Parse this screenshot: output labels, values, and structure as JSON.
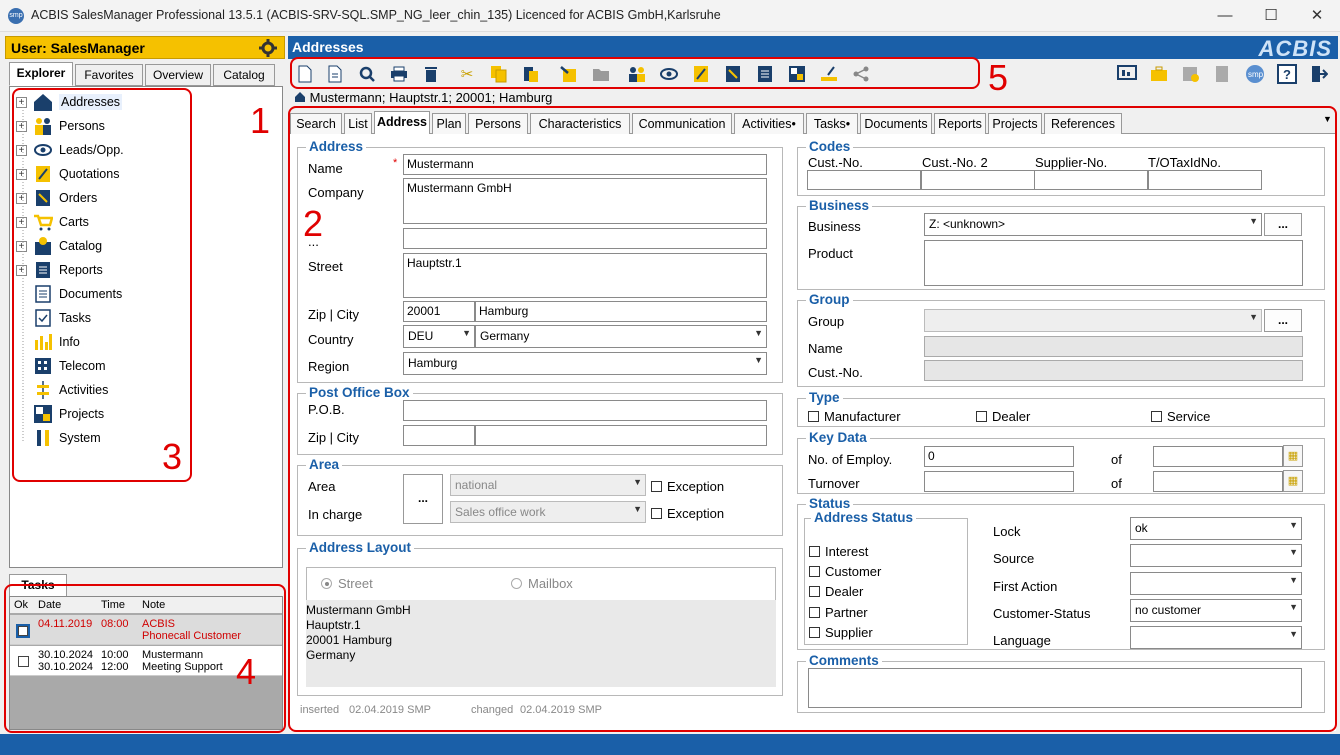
{
  "window": {
    "app_icon": "smp",
    "title": "ACBIS SalesManager Professional 13.5.1  (ACBIS-SRV-SQL.SMP_NG_leer_chin_135) Licenced for ACBIS GmbH,Karlsruhe",
    "minimize": "—",
    "maximize": "☐",
    "close": "✕"
  },
  "left": {
    "user_label": "User: SalesManager",
    "tabs": [
      "Explorer",
      "Favorites",
      "Overview",
      "Catalog"
    ],
    "tree": [
      {
        "label": "Addresses",
        "expandable": true,
        "icon": "house-icon"
      },
      {
        "label": "Persons",
        "expandable": true,
        "icon": "persons-icon"
      },
      {
        "label": "Leads/Opp.",
        "expandable": true,
        "icon": "eye-icon"
      },
      {
        "label": "Quotations",
        "expandable": true,
        "icon": "quotation-icon"
      },
      {
        "label": "Orders",
        "expandable": true,
        "icon": "orders-icon"
      },
      {
        "label": "Carts",
        "expandable": true,
        "icon": "cart-icon"
      },
      {
        "label": "Catalog",
        "expandable": true,
        "icon": "catalog-icon"
      },
      {
        "label": "Reports",
        "expandable": true,
        "icon": "reports-icon"
      },
      {
        "label": "Documents",
        "expandable": false,
        "icon": "documents-icon"
      },
      {
        "label": "Tasks",
        "expandable": false,
        "icon": "tasks-icon"
      },
      {
        "label": "Info",
        "expandable": false,
        "icon": "info-chart-icon"
      },
      {
        "label": "Telecom",
        "expandable": false,
        "icon": "telecom-icon"
      },
      {
        "label": "Activities",
        "expandable": false,
        "icon": "activities-icon"
      },
      {
        "label": "Projects",
        "expandable": false,
        "icon": "projects-icon"
      },
      {
        "label": "System",
        "expandable": false,
        "icon": "system-icon"
      }
    ],
    "tasks_tab": "Tasks",
    "task_columns": [
      "Ok",
      "Date",
      "Time",
      "Note"
    ],
    "task_rows": [
      {
        "date": "04.11.2019",
        "time": "08:00",
        "note1": "ACBIS",
        "note2": "Phonecall Customer",
        "overdue": true
      },
      {
        "date1": "30.10.2024",
        "date2": "30.10.2024",
        "time1": "10:00",
        "time2": "12:00",
        "note1": "Mustermann",
        "note2": "Meeting Support",
        "overdue": false
      }
    ]
  },
  "header": {
    "title": "Addresses",
    "logo": "ACBIS"
  },
  "breadcrumb": "Mustermann; Hauptstr.1; 20001; Hamburg",
  "tabs": [
    "Search",
    "List",
    "Address",
    "Plan",
    "Persons",
    "Characteristics",
    "Communication",
    "Activities•",
    "Tasks•",
    "Documents",
    "Reports",
    "Projects",
    "References"
  ],
  "address": {
    "section_title": "Address",
    "name_label": "Name",
    "required_mark": "*",
    "name": "Mustermann",
    "company_label": "Company",
    "company": "Mustermann GmbH",
    "extra_label": "...",
    "street_label": "Street",
    "street": "Hauptstr.1",
    "zipcity_label": "Zip | City",
    "zip": "20001",
    "city": "Hamburg",
    "country_label": "Country",
    "country_code": "DEU",
    "country": "Germany",
    "region_label": "Region",
    "region": "Hamburg"
  },
  "pob": {
    "section_title": "Post Office Box",
    "pob_label": "P.O.B.",
    "zipcity_label": "Zip | City"
  },
  "area": {
    "section_title": "Area",
    "area_label": "Area",
    "incharge_label": "In charge",
    "btn": "...",
    "area_value": "national",
    "incharge_value": "Sales office work",
    "exception_label": "Exception"
  },
  "layout": {
    "section_title": "Address Layout",
    "street_option": "Street",
    "mailbox_option": "Mailbox",
    "lines": [
      "Mustermann GmbH",
      "Hauptstr.1",
      "20001 Hamburg",
      "Germany"
    ]
  },
  "meta": {
    "inserted_label": "inserted",
    "inserted_value": "02.04.2019 SMP",
    "changed_label": "changed",
    "changed_value": "02.04.2019 SMP"
  },
  "codes": {
    "section_title": "Codes",
    "cols": [
      "Cust.-No.",
      "Cust.-No. 2",
      "Supplier-No.",
      "T/OTaxIdNo."
    ]
  },
  "business": {
    "section_title": "Business",
    "business_label": "Business",
    "business_value": "Z: <unknown>",
    "product_label": "Product",
    "btn": "..."
  },
  "group": {
    "section_title": "Group",
    "group_label": "Group",
    "name_label": "Name",
    "custno_label": "Cust.-No.",
    "btn": "..."
  },
  "type": {
    "section_title": "Type",
    "options": [
      "Manufacturer",
      "Dealer",
      "Service"
    ]
  },
  "keydata": {
    "section_title": "Key Data",
    "employ_label": "No. of Employ.",
    "employ_value": "0",
    "turnover_label": "Turnover",
    "of_label": "of"
  },
  "status": {
    "section_title": "Status",
    "address_status_title": "Address Status",
    "address_status_options": [
      "Interest",
      "Customer",
      "Dealer",
      "Partner",
      "Supplier"
    ],
    "lock_label": "Lock",
    "lock_value": "ok",
    "source_label": "Source",
    "source_value": "",
    "firstaction_label": "First Action",
    "firstaction_value": "",
    "custstatus_label": "Customer-Status",
    "custstatus_value": "no customer",
    "language_label": "Language",
    "language_value": ""
  },
  "comments": {
    "section_title": "Comments"
  },
  "annotations": [
    "1",
    "2",
    "3",
    "4",
    "5"
  ],
  "colors": {
    "accent": "#1a5fa8",
    "user_bar": "#f5c100",
    "marker": "#e00000",
    "overdue": "#d00000"
  }
}
